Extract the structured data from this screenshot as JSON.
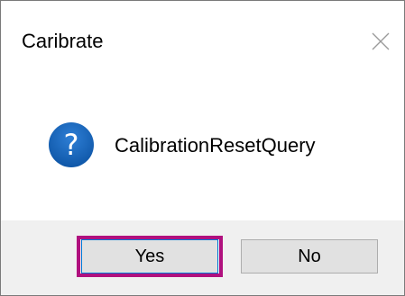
{
  "dialog": {
    "title": "Caribrate",
    "message": "CalibrationResetQuery",
    "icon": "question-icon",
    "buttons": {
      "yes_label": "Yes",
      "no_label": "No"
    },
    "colors": {
      "icon_blue": "#1565c0",
      "highlight": "#b0107e",
      "footer_bg": "#f0f0f0",
      "button_bg": "#e1e1e1"
    }
  }
}
